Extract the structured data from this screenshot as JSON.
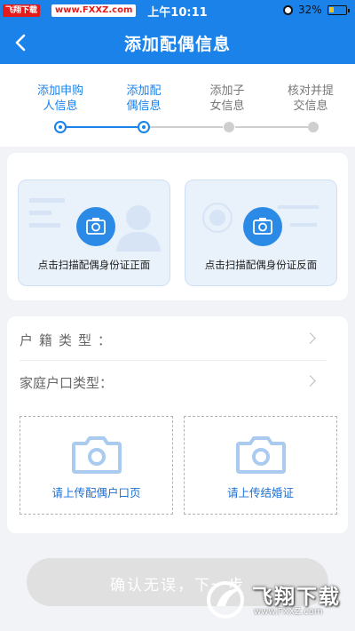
{
  "status_bar": {
    "watermark_badge": "飞翔下载",
    "watermark_url": "www.FXXZ.com",
    "time": "上午10:11",
    "battery_percent": "32%",
    "battery_level": 0.32
  },
  "navbar": {
    "title": "添加配偶信息",
    "back_icon": "chevron-left-icon"
  },
  "steps": [
    {
      "label": "添加申购\n人信息",
      "state": "done"
    },
    {
      "label": "添加配\n偶信息",
      "state": "current"
    },
    {
      "label": "添加子\n女信息",
      "state": "pending"
    },
    {
      "label": "核对并提\n交信息",
      "state": "pending"
    }
  ],
  "id_scan": {
    "front_label": "点击扫描配偶身份证正面",
    "back_label": "点击扫描配偶身份证反面",
    "camera_icon": "camera-icon"
  },
  "form": {
    "household_type_label": "户籍类型：",
    "family_household_type_label": "家庭户口类型："
  },
  "uploads": {
    "household_page_label": "请上传配偶户口页",
    "marriage_cert_label": "请上传结婚证"
  },
  "confirm_button": {
    "label": "确认无误，下一步"
  },
  "bottom_watermark": {
    "text": "飞翔下载",
    "url": "www.FXXZ.com"
  },
  "colors": {
    "primary": "#1b82ea",
    "inactive": "#cfcfcf",
    "disabled_button": "#e0e0e0"
  }
}
